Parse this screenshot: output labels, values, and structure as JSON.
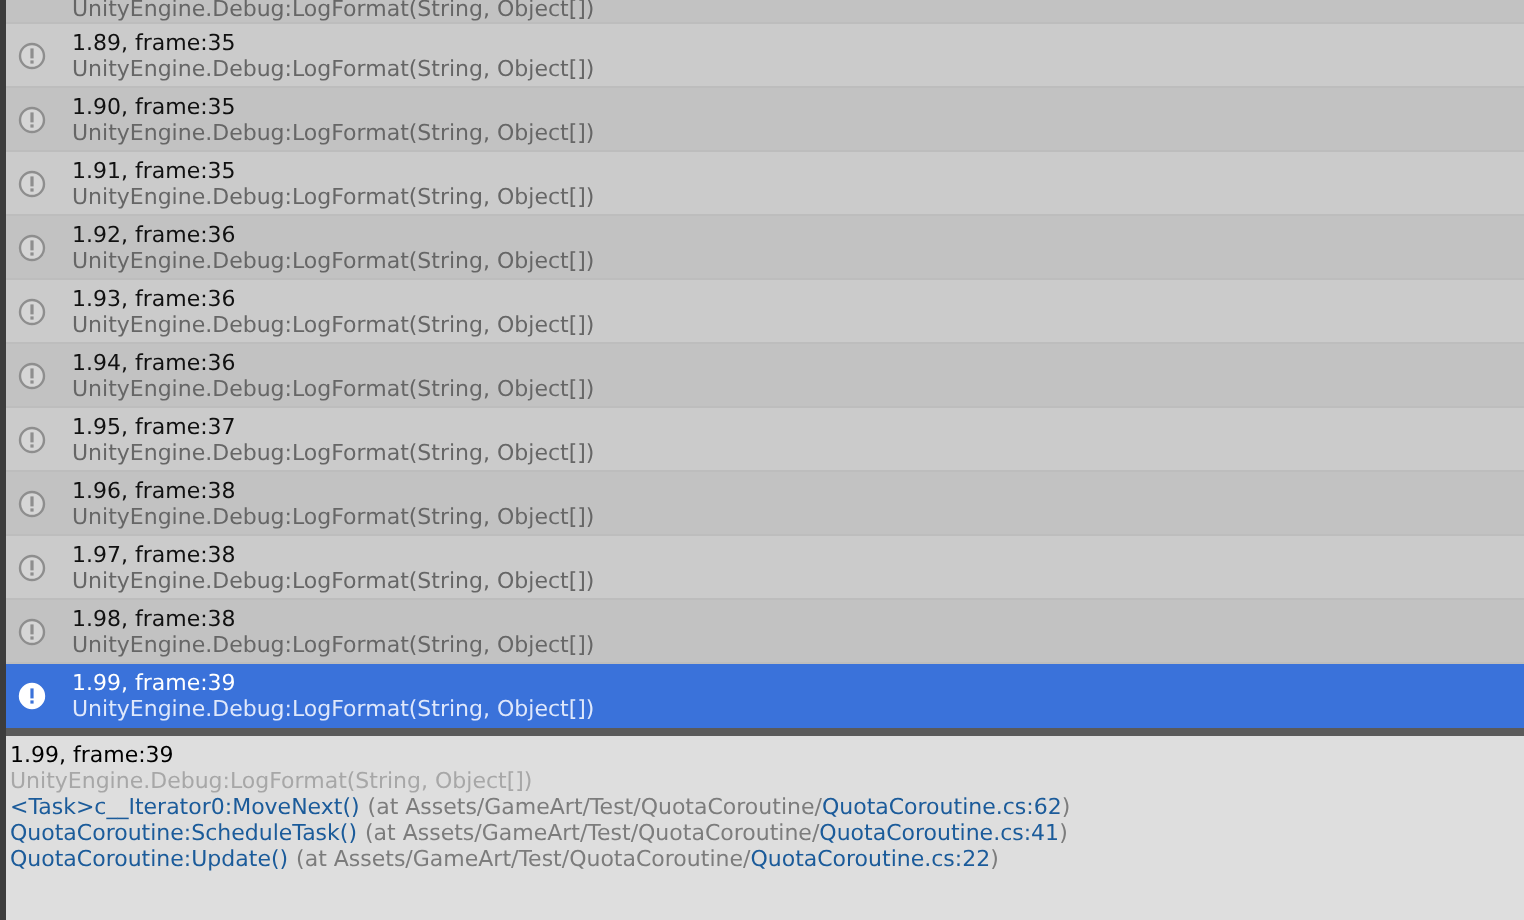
{
  "log_entries": [
    {
      "detail": "UnityEngine.Debug:LogFormat(String, Object[])",
      "selected": false
    },
    {
      "message": "1.89, frame:35",
      "detail": "UnityEngine.Debug:LogFormat(String, Object[])",
      "selected": false
    },
    {
      "message": "1.90, frame:35",
      "detail": "UnityEngine.Debug:LogFormat(String, Object[])",
      "selected": false
    },
    {
      "message": "1.91, frame:35",
      "detail": "UnityEngine.Debug:LogFormat(String, Object[])",
      "selected": false
    },
    {
      "message": "1.92, frame:36",
      "detail": "UnityEngine.Debug:LogFormat(String, Object[])",
      "selected": false
    },
    {
      "message": "1.93, frame:36",
      "detail": "UnityEngine.Debug:LogFormat(String, Object[])",
      "selected": false
    },
    {
      "message": "1.94, frame:36",
      "detail": "UnityEngine.Debug:LogFormat(String, Object[])",
      "selected": false
    },
    {
      "message": "1.95, frame:37",
      "detail": "UnityEngine.Debug:LogFormat(String, Object[])",
      "selected": false
    },
    {
      "message": "1.96, frame:38",
      "detail": "UnityEngine.Debug:LogFormat(String, Object[])",
      "selected": false
    },
    {
      "message": "1.97, frame:38",
      "detail": "UnityEngine.Debug:LogFormat(String, Object[])",
      "selected": false
    },
    {
      "message": "1.98, frame:38",
      "detail": "UnityEngine.Debug:LogFormat(String, Object[])",
      "selected": false
    },
    {
      "message": "1.99, frame:39",
      "detail": "UnityEngine.Debug:LogFormat(String, Object[])",
      "selected": true
    }
  ],
  "details_pane": {
    "message": "1.99, frame:39",
    "source": "UnityEngine.Debug:LogFormat(String, Object[])",
    "stack_trace": [
      {
        "method": "<Task>c__Iterator0:MoveNext()",
        "location": "(at Assets/GameArt/Test/QuotaCoroutine/",
        "file": "QuotaCoroutine.cs:62",
        "close": ")"
      },
      {
        "method": "QuotaCoroutine:ScheduleTask()",
        "location": "(at Assets/GameArt/Test/QuotaCoroutine/",
        "file": "QuotaCoroutine.cs:41",
        "close": ")"
      },
      {
        "method": "QuotaCoroutine:Update()",
        "location": "(at Assets/GameArt/Test/QuotaCoroutine/",
        "file": "QuotaCoroutine.cs:22",
        "close": ")"
      }
    ]
  }
}
